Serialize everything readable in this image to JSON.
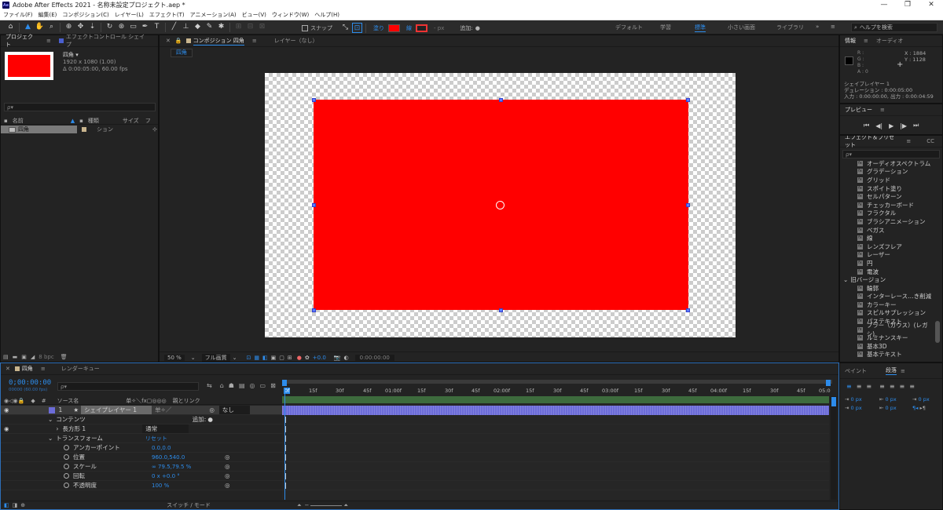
{
  "titlebar": {
    "app_icon": "Ae",
    "title": "Adobe After Effects 2021 - 名称未設定プロジェクト.aep *",
    "min": "—",
    "max": "❐",
    "close": "✕"
  },
  "menu": [
    "ファイル(F)",
    "編集(E)",
    "コンポジション(C)",
    "レイヤー(L)",
    "エフェクト(T)",
    "アニメーション(A)",
    "ビュー(V)",
    "ウィンドウ(W)",
    "ヘルプ(H)"
  ],
  "toolbar": {
    "snap_label": "スナップ",
    "fill_label": "塗り",
    "stroke_label": "線",
    "stroke_width": "- px",
    "add_label": "追加:",
    "fill_color": "#ff0000",
    "workspaces": [
      "デフォルト",
      "学習",
      "標準",
      "小さい画面",
      "ライブラリ"
    ],
    "active_workspace": "標準",
    "help_search": "ヘルプを検索"
  },
  "project": {
    "tab_project": "プロジェクト",
    "tab_effect_controls": "エフェクトコントロール シェイプ",
    "comp_name": "四角 ▾",
    "comp_info1": "1920 x 1080 (1.00)",
    "comp_info2": "Δ 0:00:05:00, 60.00 fps",
    "search_placeholder": "ρ▾",
    "col_name": "名前",
    "col_type": "種類",
    "col_size": "サイズ",
    "col_f": "フ",
    "item_name": "四角",
    "item_type": "ション",
    "footer_bpc": "8 bpc",
    "thumb_color": "#ff0000"
  },
  "comp": {
    "tab_label": "コンポジション 四角",
    "layer_label": "レイヤー（なし）",
    "breadcrumb": "四角",
    "zoom": "50 %",
    "quality": "フル画質",
    "exposure": "+0.0",
    "timecode": "0:00:00:00",
    "shape_color": "#ff0000"
  },
  "info": {
    "tab_info": "情報",
    "tab_audio": "オーディオ",
    "r": "R :",
    "g": "G :",
    "b": "B :",
    "a": "A : 0",
    "x": "X : 1884",
    "y": "Y : 1128",
    "layer_name": "シェイプレイヤー 1",
    "duration": "デュレーション : 0:00:05:00",
    "inout": "入力 : 0:00:00:00, 出力 : 0:00:04:59"
  },
  "preview": {
    "tab": "プレビュー"
  },
  "effects": {
    "tab": "エフェクト＆プリセット",
    "tab_cc": "CC",
    "search_placeholder": "ρ▾",
    "items_top": [
      "オーディオスペクトラム",
      "グラデーション",
      "グリッド",
      "スポイト塗り",
      "セルパターン",
      "チェッカーボード",
      "フラクタル",
      "ブラシアニメーション",
      "ベガス",
      "線",
      "レンズフレア",
      "レーザー",
      "円",
      "電波"
    ],
    "legacy_header": "旧バージョン",
    "items_legacy": [
      "輪郭",
      "インターレース…き削減",
      "カラーキー",
      "スピルサプレッション",
      "パステキスト",
      "ブラー（ガウス）(レガシ)",
      "ルミナンスキー",
      "基本3D",
      "基本テキスト"
    ]
  },
  "paragraph": {
    "tab_paint": "ペイント",
    "tab_paragraph": "段落",
    "px": "0 px"
  },
  "timeline": {
    "tab_comp": "四角",
    "tab_render": "レンダーキュー",
    "timecode": "0;00:00:00",
    "fps": "00000 (60.00 fps)",
    "search_placeholder": "ρ▾",
    "col_source": "ソース名",
    "col_parent": "親とリンク",
    "layer_num": "1",
    "layer_name": "シェイプレイヤー 1",
    "parent": "なし",
    "contents": "コンテンツ",
    "add": "追加:",
    "rect": "長方形 1",
    "blend": "通常",
    "transform": "トランスフォーム",
    "reset": "リセット",
    "props": [
      {
        "name": "アンカーポイント",
        "value": "0.0,0.0"
      },
      {
        "name": "位置",
        "value": "960.0,540.0"
      },
      {
        "name": "スケール",
        "value": "∞ 79.5,79.5 %"
      },
      {
        "name": "回転",
        "value": "0 x +0.0 °"
      },
      {
        "name": "不透明度",
        "value": "100 %"
      }
    ],
    "footer": "スイッチ / モード",
    "ruler": [
      "0f",
      "15f",
      "30f",
      "45f",
      "01:00f",
      "15f",
      "30f",
      "45f",
      "02:00f",
      "15f",
      "30f",
      "45f",
      "03:00f",
      "15f",
      "30f",
      "45f",
      "04:00f",
      "15f",
      "30f",
      "45f",
      "05:0"
    ],
    "layer_bar_color": "#6c6cd8"
  }
}
